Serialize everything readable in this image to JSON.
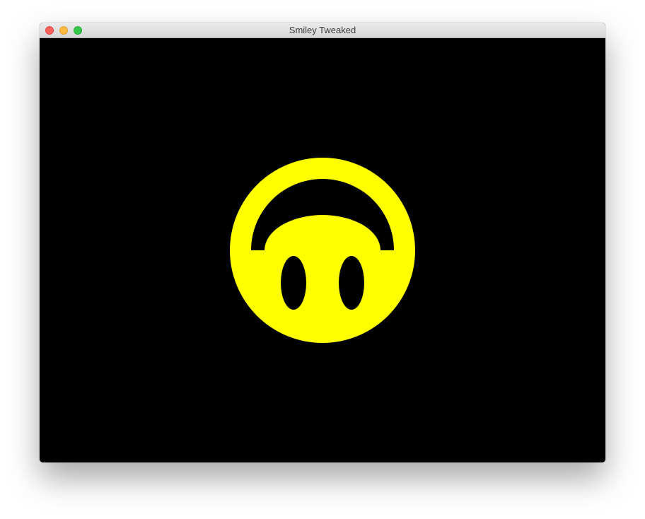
{
  "window": {
    "title": "Smiley Tweaked"
  },
  "traffic_lights": {
    "close": "close-button",
    "minimize": "minimize-button",
    "zoom": "zoom-button"
  },
  "canvas": {
    "background": "#000000",
    "face_color": "#ffff00",
    "feature_color": "#000000"
  }
}
